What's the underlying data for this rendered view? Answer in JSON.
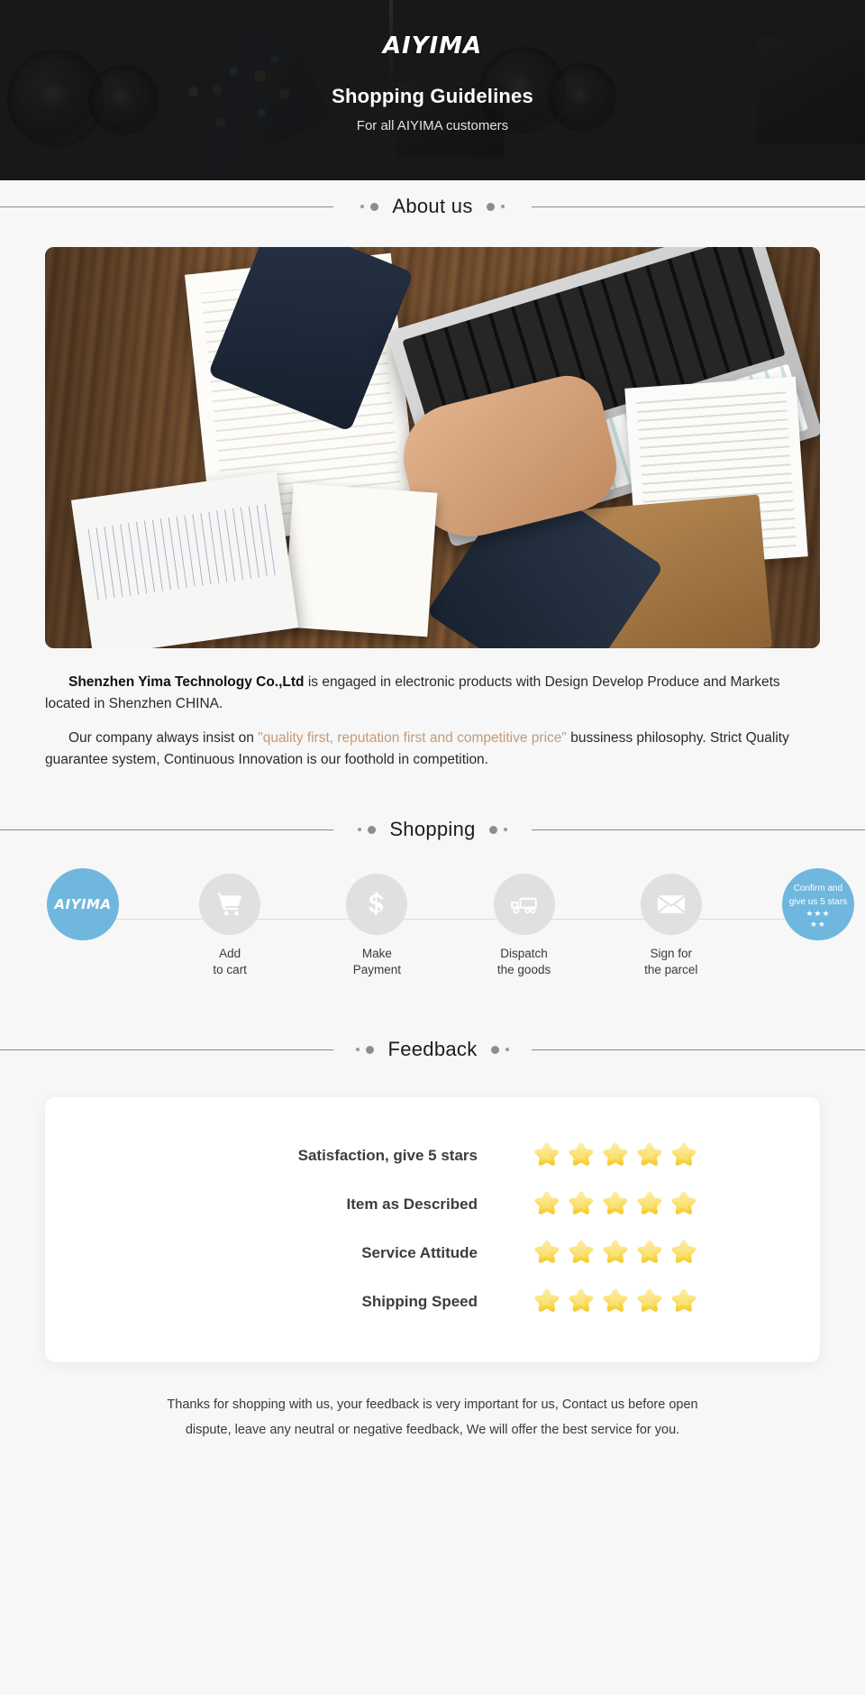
{
  "banner": {
    "brand": "AIYIMA",
    "title": "Shopping Guidelines",
    "subtitle": "For all AIYIMA customers"
  },
  "sections": {
    "about_title": "About us",
    "shopping_title": "Shopping",
    "feedback_title": "Feedback"
  },
  "about": {
    "p1_bold": "Shenzhen Yima Technology Co.,Ltd",
    "p1_rest": " is engaged in electronic products with Design Develop Produce and Markets located in Shenzhen CHINA.",
    "p2_start": "Our company always insist on ",
    "p2_accent": "\"quality first, reputation first and competitive price\"",
    "p2_rest": " bussiness philosophy. Strict Quality guarantee system, Continuous Innovation is our foothold in competition."
  },
  "steps": [
    {
      "icon": "aiyima-logo-icon",
      "logo": "AIYIMA",
      "label_line1": "",
      "label_line2": ""
    },
    {
      "icon": "shopping-cart-icon",
      "label_line1": "Add",
      "label_line2": "to cart"
    },
    {
      "icon": "dollar-sign-icon",
      "label_line1": "Make",
      "label_line2": "Payment"
    },
    {
      "icon": "delivery-truck-icon",
      "label_line1": "Dispatch",
      "label_line2": "the goods"
    },
    {
      "icon": "envelope-icon",
      "label_line1": "Sign for",
      "label_line2": "the parcel"
    },
    {
      "icon": "five-stars-icon",
      "final_line1": "Confirm and",
      "final_line2": "give us 5 stars",
      "stars_top": "★★★",
      "stars_bottom": "★★",
      "label_line1": "",
      "label_line2": ""
    }
  ],
  "feedback": {
    "rows": [
      {
        "label": "Satisfaction, give 5 stars",
        "stars": 5
      },
      {
        "label": "Item as Described",
        "stars": 5
      },
      {
        "label": "Service Attitude",
        "stars": 5
      },
      {
        "label": "Shipping Speed",
        "stars": 5
      }
    ]
  },
  "footer": {
    "line1": "Thanks for shopping with us, your feedback is very important for us, Contact us before open",
    "line2": "dispute, leave any neutral or negative feedback, We will offer the best service for you."
  },
  "colors": {
    "banner_bg": "#181818",
    "page_bg": "#f7f7f7",
    "brand_blue": "#6fb7de",
    "accent_tan": "#c49a78",
    "step_grey": "#e0e0e0",
    "star_yellow": "#f7d046"
  }
}
